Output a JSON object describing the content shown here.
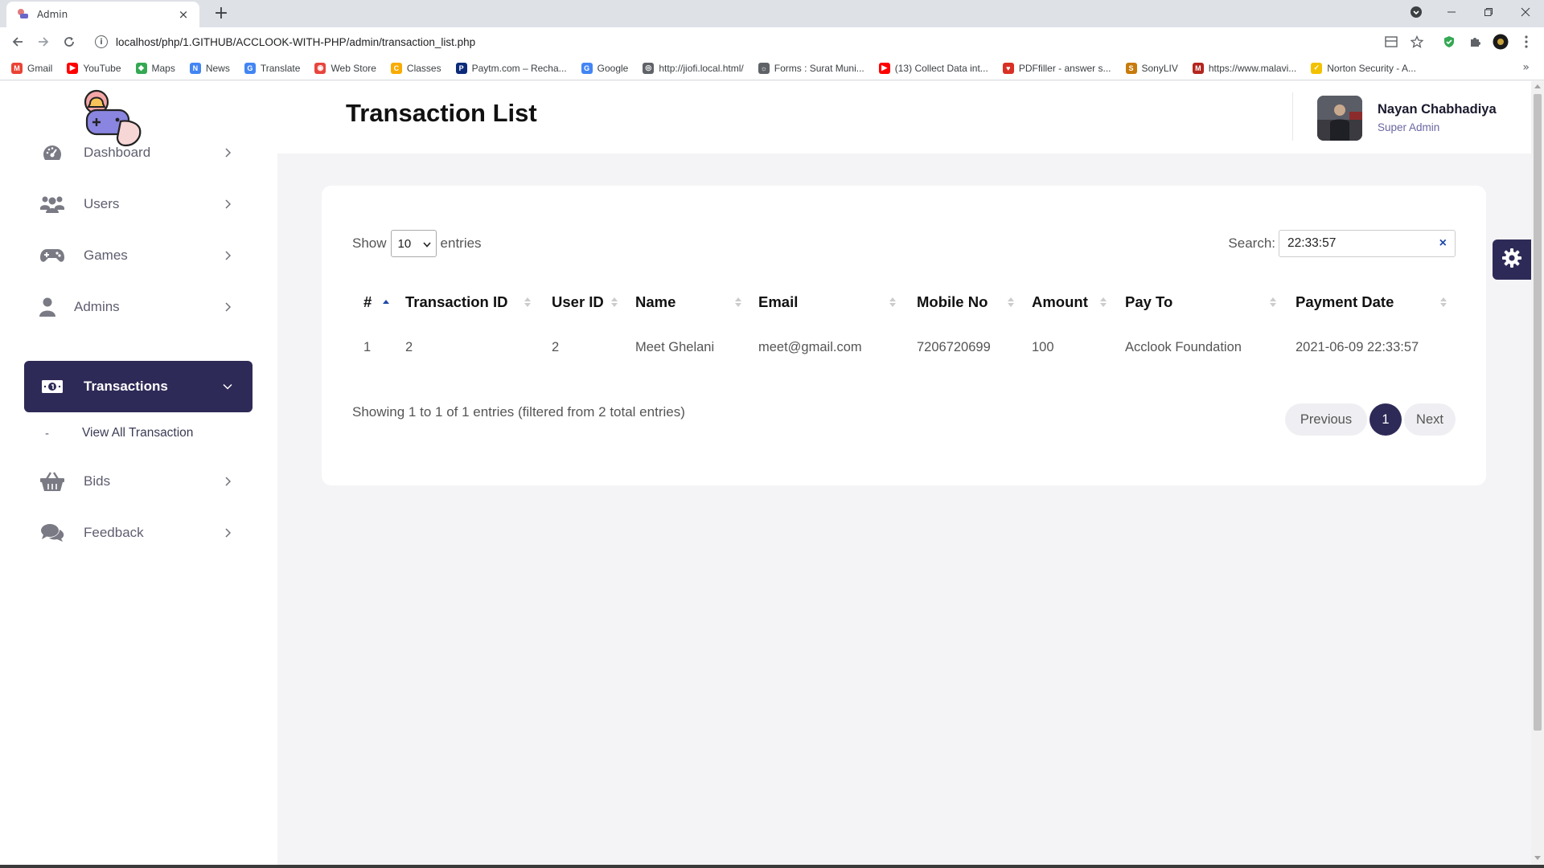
{
  "browser": {
    "tab_title": "Admin",
    "tab_close": "×",
    "new_tab": "+",
    "url": "localhost/php/1.GITHUB/ACCLOOK-WITH-PHP/admin/transaction_list.php",
    "bookmarks": [
      {
        "label": "Gmail",
        "icon": "gmail-icon",
        "color": "#ea4335",
        "glyph": "M"
      },
      {
        "label": "YouTube",
        "icon": "youtube-icon",
        "color": "#ff0000",
        "glyph": "▶"
      },
      {
        "label": "Maps",
        "icon": "maps-icon",
        "color": "#34a853",
        "glyph": "◆"
      },
      {
        "label": "News",
        "icon": "news-icon",
        "color": "#4285f4",
        "glyph": "N"
      },
      {
        "label": "Translate",
        "icon": "translate-icon",
        "color": "#4285f4",
        "glyph": "G"
      },
      {
        "label": "Web Store",
        "icon": "webstore-icon",
        "color": "#e8453c",
        "glyph": "◉"
      },
      {
        "label": "Classes",
        "icon": "classroom-icon",
        "color": "#f9ab00",
        "glyph": "C"
      },
      {
        "label": "Paytm.com – Recha...",
        "icon": "paytm-icon",
        "color": "#0b2a7a",
        "glyph": "P"
      },
      {
        "label": "Google",
        "icon": "google-icon",
        "color": "#4285f4",
        "glyph": "G"
      },
      {
        "label": "http://jiofi.local.html/",
        "icon": "globe-icon",
        "color": "#5f6368",
        "glyph": "◎"
      },
      {
        "label": "Forms : Surat Muni...",
        "icon": "forms-icon",
        "color": "#5f6368",
        "glyph": "☼"
      },
      {
        "label": "(13) Collect Data int...",
        "icon": "youtube-icon",
        "color": "#ff0000",
        "glyph": "▶"
      },
      {
        "label": "PDFfiller - answer s...",
        "icon": "pdffiller-icon",
        "color": "#d93025",
        "glyph": "♥"
      },
      {
        "label": "SonyLIV",
        "icon": "sonyliv-icon",
        "color": "#c77b0c",
        "glyph": "S"
      },
      {
        "label": "https://www.malavi...",
        "icon": "malavi-icon",
        "color": "#b3261e",
        "glyph": "M"
      },
      {
        "label": "Norton Security - A...",
        "icon": "norton-icon",
        "color": "#f2c200",
        "glyph": "✓"
      }
    ]
  },
  "sidebar": {
    "items": [
      {
        "label": "Dashboard",
        "icon": "dashboard-gauge-icon"
      },
      {
        "label": "Users",
        "icon": "users-icon"
      },
      {
        "label": "Games",
        "icon": "gamepad-icon"
      },
      {
        "label": "Admins",
        "icon": "admin-user-icon"
      },
      {
        "label": "Transactions",
        "icon": "money-bill-icon",
        "active": true
      },
      {
        "label": "Bids",
        "icon": "basket-icon"
      },
      {
        "label": "Feedback",
        "icon": "comments-icon"
      }
    ],
    "subitem": {
      "dash": "-",
      "label": "View All Transaction"
    }
  },
  "header": {
    "title": "Transaction List",
    "user_name": "Nayan Chabhadiya",
    "user_role": "Super Admin"
  },
  "table_controls": {
    "show_label": "Show",
    "entries_value": "10",
    "entries_label": "entries",
    "search_label": "Search:",
    "search_value": "22:33:57",
    "search_clear": "×"
  },
  "table": {
    "columns": [
      "#",
      "Transaction ID",
      "User ID",
      "Name",
      "Email",
      "Mobile No",
      "Amount",
      "Pay To",
      "Payment Date"
    ],
    "rows": [
      [
        "1",
        "2",
        "2",
        "Meet Ghelani",
        "meet@gmail.com",
        "7206720699",
        "100",
        "Acclook Foundation",
        "2021-06-09 22:33:57"
      ]
    ]
  },
  "footer": {
    "info": "Showing 1 to 1 of 1 entries (filtered from 2 total entries)",
    "previous": "Previous",
    "page": "1",
    "next": "Next"
  },
  "colors": {
    "accent": "#2e2a57",
    "subtitle": "#6a67a0"
  }
}
